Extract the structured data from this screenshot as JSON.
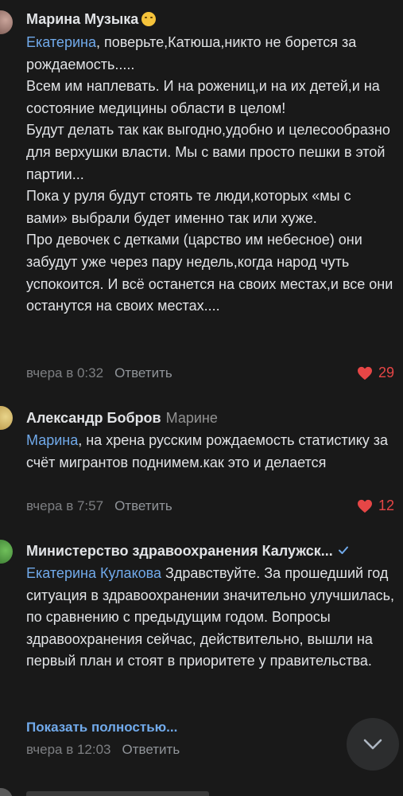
{
  "comments": [
    {
      "author": "Марина Музыка",
      "mention": "Екатерина",
      "text": ", поверьте,Катюша,никто не борется за рождаемость.....\nВсем им наплевать. И на рожениц,и на их детей,и на состояние медицины области в целом!\nБудут делать так как выгодно,удобно и целесообразно для верхушки власти. Мы с вами просто пешки в этой партии...\nПока у руля будут стоять те люди,которых «мы с вами» выбрали будет именно так или хуже.\nПро девочек с детками (царство им небесное) они забудут уже через пару недель,когда народ чуть успокоится. И всё останется на своих местах,и все они останутся на своих местах....",
      "time": "вчера в 0:32",
      "reply_label": "Ответить",
      "likes": "29"
    },
    {
      "author": "Александр Бобров",
      "reply_to": "Марине",
      "mention": "Марина",
      "text": ", на хрена русским рождаемость статистику за счёт мигрантов поднимем.как это и делается",
      "time": "вчера в 7:57",
      "reply_label": "Ответить",
      "likes": "12"
    },
    {
      "author": "Министерство здравоохранения Калужск...",
      "mention": "Екатерина Кулакова",
      "text": " Здравствуйте. За прошедший год ситуация в здравоохранении значительно улучшилась, по сравнению с предыдущим годом. Вопросы здравоохранения сейчас, действительно, вышли на первый план и стоят в приоритете у правительства.",
      "show_more": "Показать полностью...",
      "time": "вчера в 12:03",
      "reply_label": "Ответить"
    }
  ],
  "colors": {
    "background": "#191919",
    "link": "#71aaeb",
    "like": "#e64646",
    "meta": "#7d7f82"
  },
  "icons": [
    "heart-icon",
    "verified-icon",
    "chevron-down-icon",
    "smile-emoji-icon"
  ]
}
